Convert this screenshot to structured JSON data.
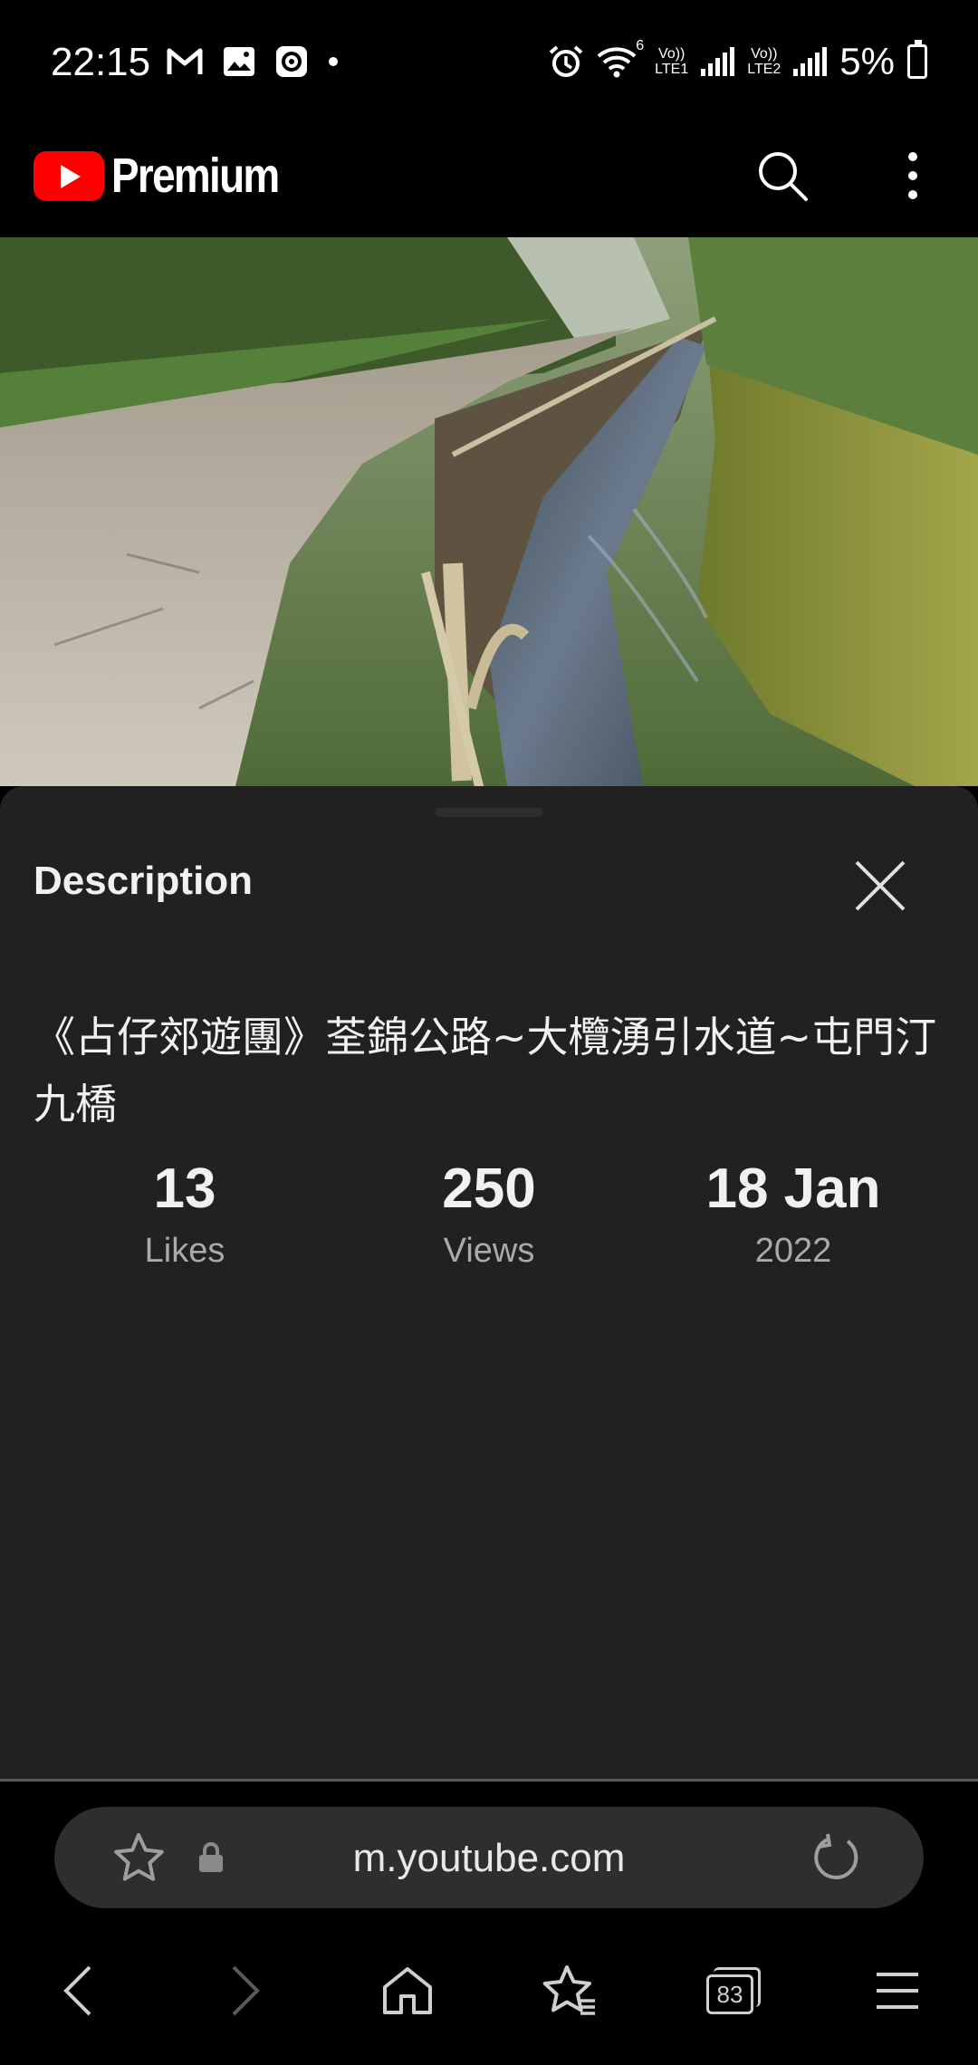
{
  "status_bar": {
    "time": "22:15",
    "left_icons": [
      "gmail-icon",
      "gallery-icon",
      "sync-icon",
      "dot-icon"
    ],
    "right_icons": [
      "alarm-icon",
      "wifi-icon",
      "signal-lte1-icon",
      "signal-lte2-icon",
      "battery-charging-icon"
    ],
    "lte1_top": "Vo))",
    "lte1_bottom": "LTE1",
    "lte2_top": "Vo))",
    "lte2_bottom": "LTE2",
    "wifi_badge": "6",
    "battery": "5%"
  },
  "app_bar": {
    "logo_text": "Premium",
    "actions": [
      "search-icon",
      "more-vertical-icon"
    ]
  },
  "video": {
    "description": "thumbnail-image"
  },
  "description_panel": {
    "header": "Description",
    "video_title": "《占仔郊遊團》荃錦公路~大欖湧引水道~屯門汀九橋",
    "stats": [
      {
        "value": "13",
        "label": "Likes"
      },
      {
        "value": "250",
        "label": "Views"
      },
      {
        "value": "18 Jan",
        "label": "2022"
      }
    ]
  },
  "browser": {
    "url": "m.youtube.com",
    "tab_count": "83",
    "nav": [
      "back-icon",
      "forward-icon",
      "home-icon",
      "bookmarks-icon",
      "tabs-icon",
      "menu-icon"
    ]
  }
}
